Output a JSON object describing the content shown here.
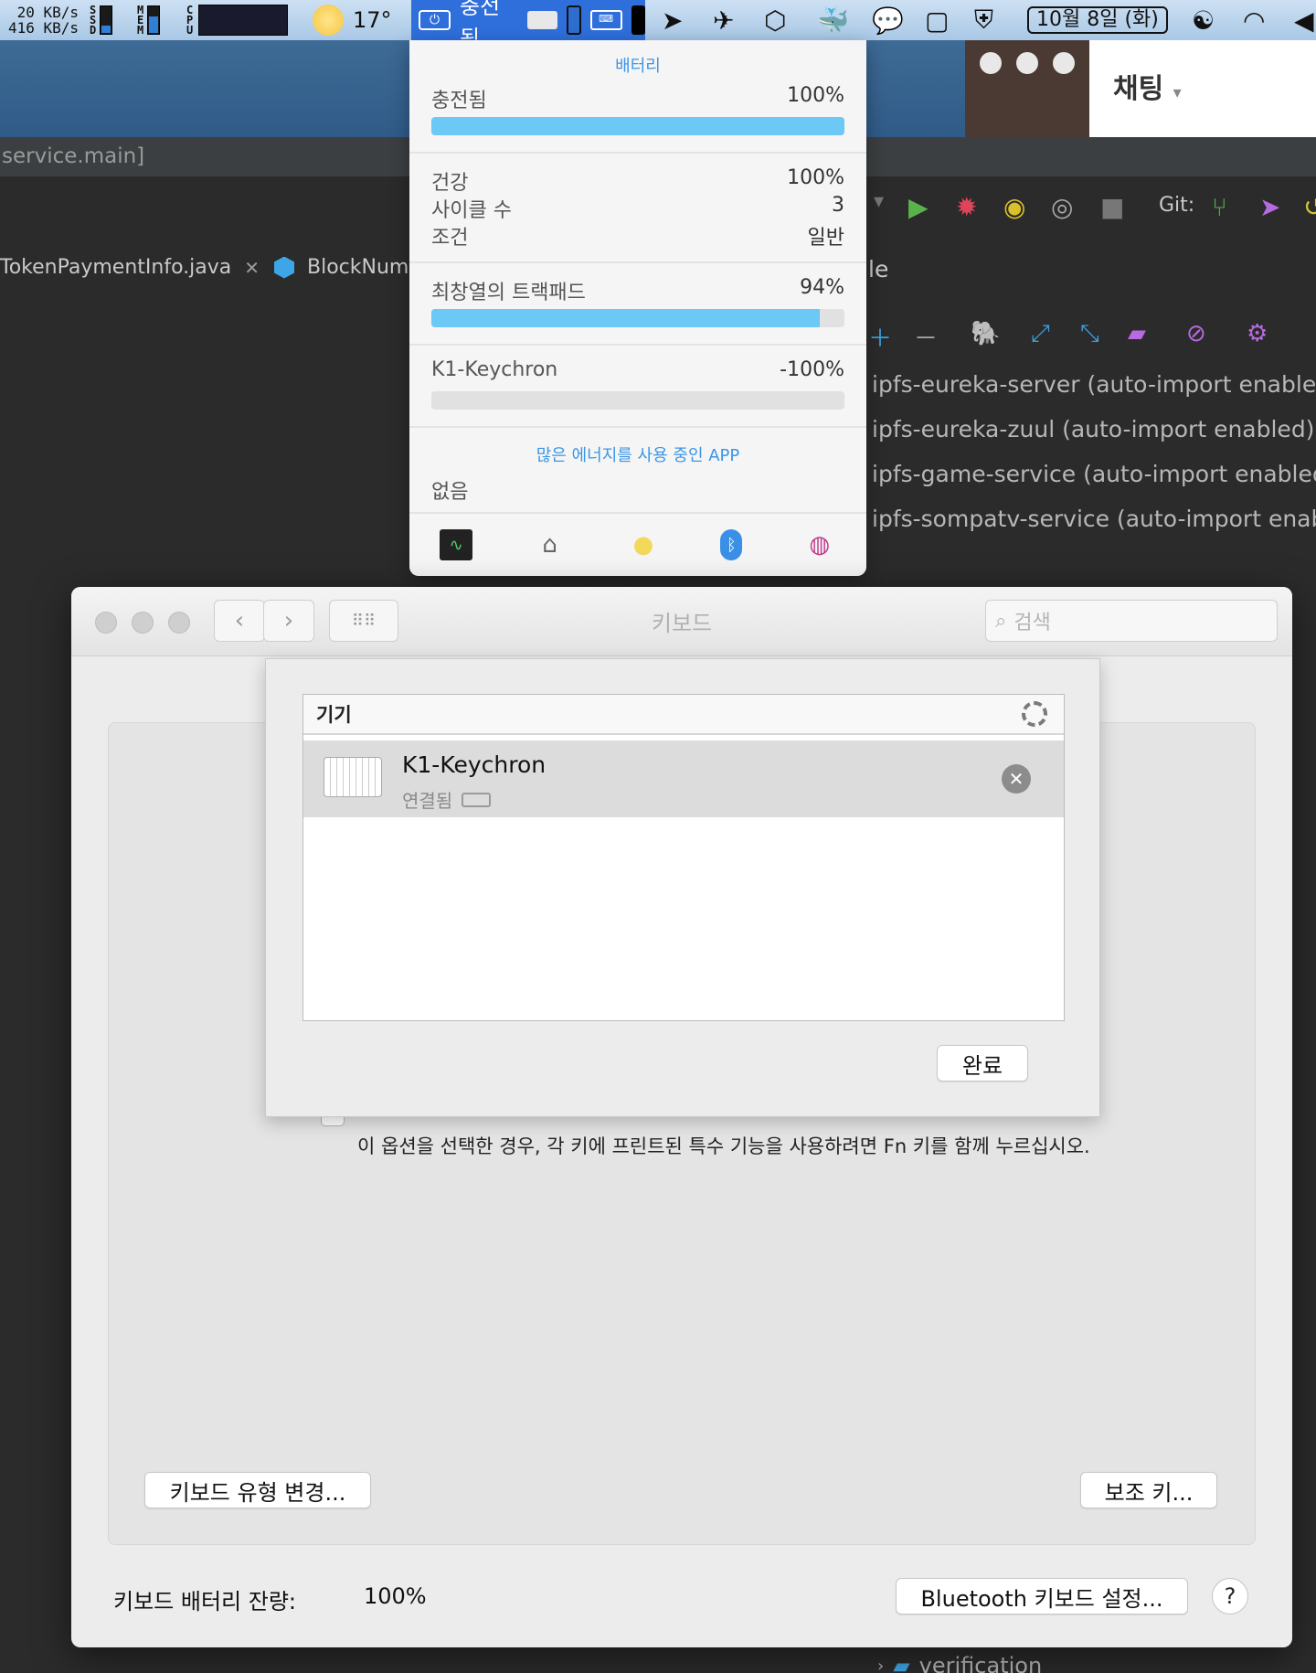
{
  "menubar": {
    "net_up": "20 KB/s",
    "net_down": "416 KB/s",
    "ssd_label": "SSD",
    "mem_label": "MEM",
    "cpu_label": "CPU",
    "weather_temp": "17°",
    "battery_status": "충전됨",
    "date": "10월 8일 (화)"
  },
  "ide": {
    "path_text": "service.main]",
    "tab1": "TokenPaymentInfo.java",
    "tab2": "BlockNumb",
    "panel_fragment": "le",
    "git_label": "Git:",
    "gradle_projects": [
      "ipfs-eureka-server (auto-import enabled",
      "ipfs-eureka-zuul (auto-import enabled)",
      "ipfs-game-service (auto-import enabled",
      "ipfs-sompatv-service (auto-import enab"
    ],
    "tree_item": "verification"
  },
  "chat_window": {
    "title": "채팅"
  },
  "battery_popover": {
    "header": "배터리",
    "charged_label": "충전됨",
    "charged_value": "100%",
    "charged_level": 1.0,
    "health_label": "건강",
    "health_value": "100%",
    "cycles_label": "사이클 수",
    "cycles_value": "3",
    "condition_label": "조건",
    "condition_value": "일반",
    "trackpad_label": "최창열의 트랙패드",
    "trackpad_value": "94%",
    "trackpad_level": 0.94,
    "keyboard_label": "K1-Keychron",
    "keyboard_value": "-100%",
    "keyboard_level": 0,
    "energy_header": "많은 에너지를 사용 중인 APP",
    "energy_none": "없음",
    "footer_icons": [
      "activity-monitor-icon",
      "cleaner-icon",
      "bulb-icon",
      "bluetooth-icon",
      "speedometer-icon"
    ]
  },
  "prefs_window": {
    "title": "키보드",
    "search_placeholder": "검색",
    "fn_description": "이 옵션을 선택한 경우, 각 키에 프린트된 특수 기능을 사용하려면 Fn 키를 함께 누르십시오.",
    "change_type_button": "키보드 유형 변경...",
    "modifier_button": "보조 키...",
    "battery_label": "키보드 배터리 잔량:",
    "battery_value": "100%",
    "bt_setup_button": "Bluetooth 키보드 설정...",
    "help_button": "?"
  },
  "bt_sheet": {
    "list_header": "기기",
    "device_name": "K1-Keychron",
    "device_status": "연결됨",
    "done_button": "완료"
  }
}
